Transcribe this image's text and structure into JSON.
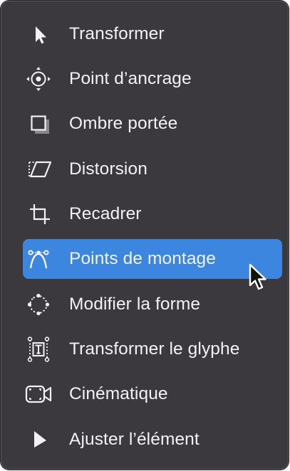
{
  "menu": {
    "items": [
      {
        "label": "Transformer",
        "icon": "pointer-arrow-icon",
        "selected": false
      },
      {
        "label": "Point d’ancrage",
        "icon": "anchor-point-icon",
        "selected": false
      },
      {
        "label": "Ombre portée",
        "icon": "drop-shadow-icon",
        "selected": false
      },
      {
        "label": "Distorsion",
        "icon": "distort-icon",
        "selected": false
      },
      {
        "label": "Recadrer",
        "icon": "crop-icon",
        "selected": false
      },
      {
        "label": "Points de montage",
        "icon": "edit-points-icon",
        "selected": true
      },
      {
        "label": "Modifier la forme",
        "icon": "edit-shape-icon",
        "selected": false
      },
      {
        "label": "Transformer le glyphe",
        "icon": "transform-glyph-icon",
        "selected": false
      },
      {
        "label": "Cinématique",
        "icon": "kinematic-icon",
        "selected": false
      },
      {
        "label": "Ajuster l’élément",
        "icon": "adjust-item-icon",
        "selected": false
      }
    ]
  },
  "colors": {
    "menu_background": "#3b393e",
    "selection": "#3d86e0",
    "text": "#f2f2f4"
  }
}
